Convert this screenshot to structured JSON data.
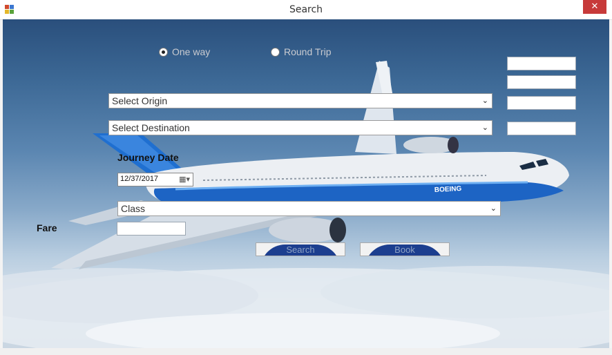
{
  "window": {
    "title": "Search",
    "close_glyph": "✕"
  },
  "trip_type": {
    "one_way": {
      "label": "One way",
      "checked": true
    },
    "round_trip": {
      "label": "Round Trip",
      "checked": false
    }
  },
  "origin": {
    "value": "Select Origin"
  },
  "destination": {
    "value": "Select Destination"
  },
  "journey_date": {
    "label": "Journey Date",
    "value": "12/37/2017"
  },
  "class_select": {
    "value": "Class"
  },
  "fare": {
    "label": "Fare",
    "value": ""
  },
  "buttons": {
    "search": "Search",
    "book": "Book"
  },
  "aux_fields": [
    "",
    "",
    "",
    ""
  ],
  "airplane_text": "BOEING",
  "colors": {
    "close_red": "#c73a3a",
    "button_arc": "#1c3e8f",
    "fuselage_blue": "#1d64c4"
  }
}
